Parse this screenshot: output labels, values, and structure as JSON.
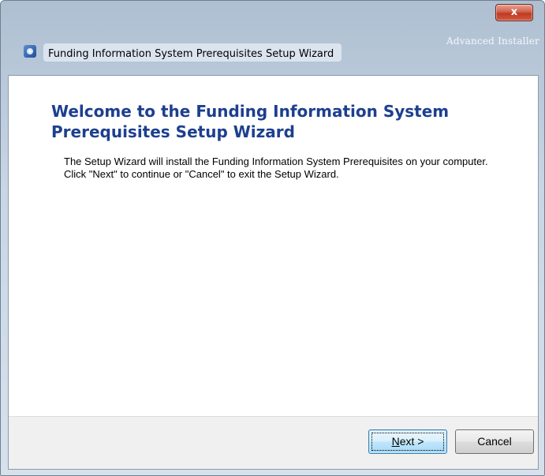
{
  "window": {
    "title": "Funding Information System Prerequisites Setup Wizard",
    "brand": "Advanced Installer",
    "close_glyph": "x"
  },
  "content": {
    "heading": "Welcome to the Funding Information System Prerequisites Setup Wizard",
    "body": "The Setup Wizard will install the Funding Information System Prerequisites on your computer.  Click \"Next\" to continue or \"Cancel\" to exit the Setup Wizard."
  },
  "buttons": {
    "next_mnemonic": "N",
    "next_rest": "ext >",
    "cancel": "Cancel"
  }
}
